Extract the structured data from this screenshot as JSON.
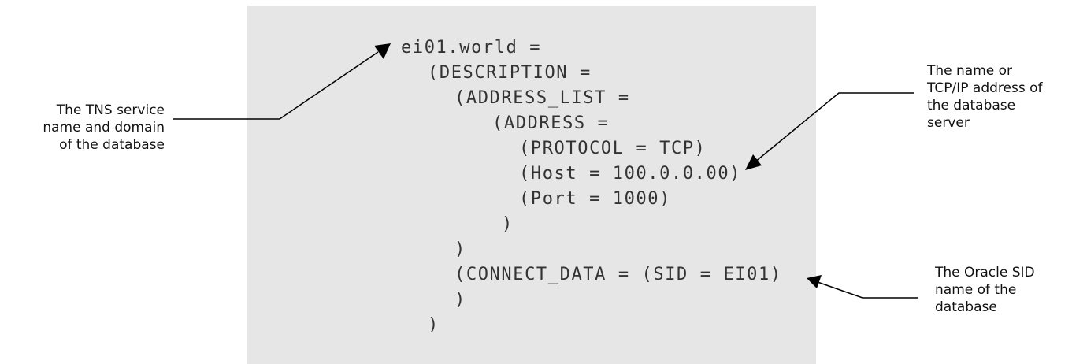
{
  "code_lines": [
    "ei01.world =",
    "(DESCRIPTION =",
    "(ADDRESS_LIST =",
    "(ADDRESS =",
    "(PROTOCOL = TCP)",
    "(Host = 100.0.0.00)",
    "(Port = 1000)",
    ")",
    ")",
    "(CONNECT_DATA = (SID = EI01)",
    ")",
    ")"
  ],
  "callouts": {
    "tns": [
      "The TNS service",
      "name and domain",
      "of the database"
    ],
    "host": [
      "The name or",
      "TCP/IP address of",
      "the database",
      "server"
    ],
    "sid": [
      "The Oracle SID",
      "name of the",
      "database"
    ]
  },
  "colors": {
    "code_background": "#e6e6e6",
    "code_text": "#333333",
    "arrow": "#000000"
  }
}
